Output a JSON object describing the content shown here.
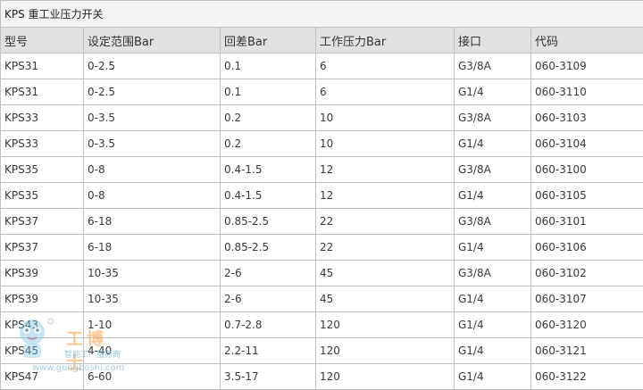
{
  "table": {
    "title": "KPS 重工业压力开关",
    "headers": [
      "型号",
      "设定范围Bar",
      "回差Bar",
      "工作压力Bar",
      "接口",
      "代码"
    ],
    "rows": [
      [
        "KPS31",
        "0-2.5",
        "0.1",
        "6",
        "G3/8A",
        "060-3109"
      ],
      [
        "KPS31",
        "0-2.5",
        "0.1",
        "6",
        "G1/4",
        "060-3110"
      ],
      [
        "KPS33",
        "0-3.5",
        "0.2",
        "10",
        "G3/8A",
        "060-3103"
      ],
      [
        "KPS33",
        "0-3.5",
        "0.2",
        "10",
        "G1/4",
        "060-3104"
      ],
      [
        "KPS35",
        "0-8",
        "0.4-1.5",
        "12",
        "G3/8A",
        "060-3100"
      ],
      [
        "KPS35",
        "0-8",
        "0.4-1.5",
        "12",
        "G1/4",
        "060-3105"
      ],
      [
        "KPS37",
        "6-18",
        "0.85-2.5",
        "22",
        "G3/8A",
        "060-3101"
      ],
      [
        "KPS37",
        "6-18",
        "0.85-2.5",
        "22",
        "G1/4",
        "060-3106"
      ],
      [
        "KPS39",
        "10-35",
        "2-6",
        "45",
        "G3/8A",
        "060-3102"
      ],
      [
        "KPS39",
        "10-35",
        "2-6",
        "45",
        "G1/4",
        "060-3107"
      ],
      [
        "KPS43",
        "1-10",
        "0.7-2.8",
        "120",
        "G1/4",
        "060-3120"
      ],
      [
        "KPS45",
        "4-40",
        "2.2-11",
        "120",
        "G1/4",
        "060-3121"
      ],
      [
        "KPS47",
        "6-60",
        "3.5-17",
        "120",
        "G1/4",
        "060-3122"
      ]
    ]
  },
  "watermark": {
    "brand": "工博士",
    "tagline": "智能工厂服务商",
    "url": "www.gongboshi.com",
    "colors": {
      "brand": "#ff9a3c",
      "mascot": "#7fc4e6"
    }
  }
}
